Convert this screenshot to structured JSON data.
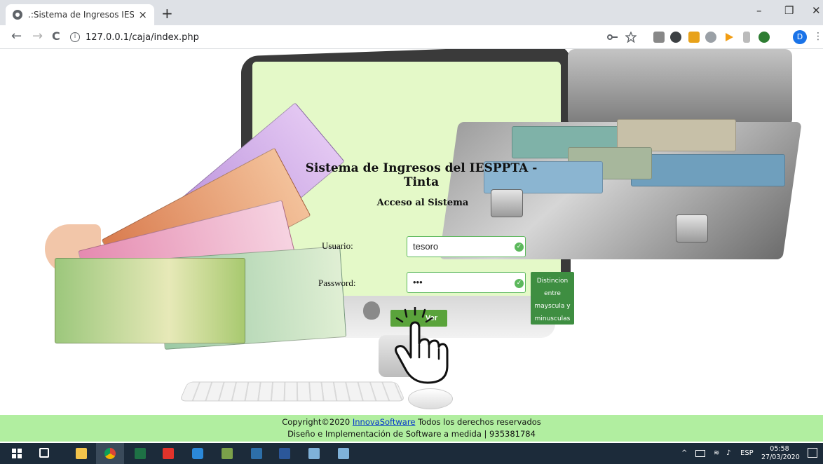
{
  "browser": {
    "tab_title": ".:Sistema de Ingresos IESPPTA:.",
    "tab_close": "×",
    "new_tab": "+",
    "url": "127.0.0.1/caja/index.php",
    "profile_initial": "D",
    "window_controls": {
      "minimize": "–",
      "maximize": "❐",
      "close": "✕"
    },
    "nav": {
      "back": "←",
      "forward": "→",
      "reload": "C"
    }
  },
  "login": {
    "title": "Sistema de Ingresos del IESPPTA - Tinta",
    "subtitle": "Acceso al Sistema",
    "username_label": "Usuario:",
    "username_value": "tesoro",
    "password_label": "Password:",
    "password_value": "•••",
    "case_hint": "Distincion entre mayscula y minusculas",
    "submit_label": "Ver"
  },
  "footer": {
    "copyright_prefix": "Copyright©2020",
    "company_link": "InnovaSoftware",
    "copyright_suffix": "Todos los derechos reservados",
    "line2": "Diseño e Implementación de Software a medida | 935381784"
  },
  "taskbar": {
    "language": "ESP",
    "time": "05:58",
    "date": "27/03/2020"
  },
  "colors": {
    "screen_bg": "#e4f9c8",
    "footer_bg": "#b1eea0",
    "accent_green": "#5cb85c",
    "hint_bg": "#3e8e41",
    "taskbar_bg": "#1c2b3a"
  },
  "icons": [
    "globe-icon",
    "info-icon",
    "key-icon",
    "star-icon",
    "windows-start-icon",
    "chrome-icon",
    "excel-icon",
    "word-icon",
    "check-icon",
    "pointer-hand-icon"
  ]
}
